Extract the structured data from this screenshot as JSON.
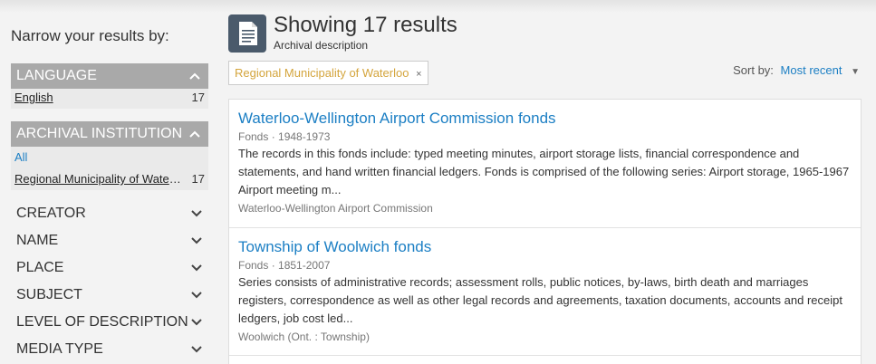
{
  "sidebar": {
    "title": "Narrow your results by:",
    "language": {
      "header": "LANGUAGE",
      "items": [
        {
          "label": "English",
          "count": "17"
        }
      ]
    },
    "institution": {
      "header": "ARCHIVAL INSTITUTION",
      "all_label": "All",
      "items": [
        {
          "label": "Regional Municipality of Waterloo",
          "count": "17"
        }
      ]
    },
    "collapsed": [
      "CREATOR",
      "NAME",
      "PLACE",
      "SUBJECT",
      "LEVEL OF DESCRIPTION",
      "MEDIA TYPE"
    ]
  },
  "main": {
    "heading": "Showing 17 results",
    "subheading": "Archival description",
    "filter_tag": "Regional Municipality of Waterloo",
    "filter_remove": "×",
    "sort_label": "Sort by:",
    "sort_value": "Most recent"
  },
  "results": [
    {
      "title": "Waterloo-Wellington Airport Commission fonds",
      "level": "Fonds",
      "dates": "1948-1973",
      "description": "The records in this fonds include: typed meeting minutes, airport storage lists, financial correspondence and statements, and hand written financial ledgers. Fonds is comprised of the following series: Airport storage, 1965-1967 Airport meeting m...",
      "creator": "Waterloo-Wellington Airport Commission"
    },
    {
      "title": "Township of Woolwich fonds",
      "level": "Fonds",
      "dates": "1851-2007",
      "description": "Series consists of administrative records; assessment rolls, public notices, by-laws, birth death and marriages registers, correspondence as well as other legal records and agreements, taxation documents, accounts and receipt ledgers, job cost led...",
      "creator": "Woolwich (Ont. : Township)"
    }
  ],
  "icons": {
    "facet_expanded": "chevron-up-icon",
    "facet_collapsed": "chevron-down-icon",
    "description": "document-icon",
    "sort": "caret-down-icon"
  },
  "colors": {
    "link": "#1c7fc4",
    "facet_header": "#a9a9a9",
    "filter_tag_text": "#d4a53d",
    "doc_icon_bg": "#4a5a6b"
  }
}
